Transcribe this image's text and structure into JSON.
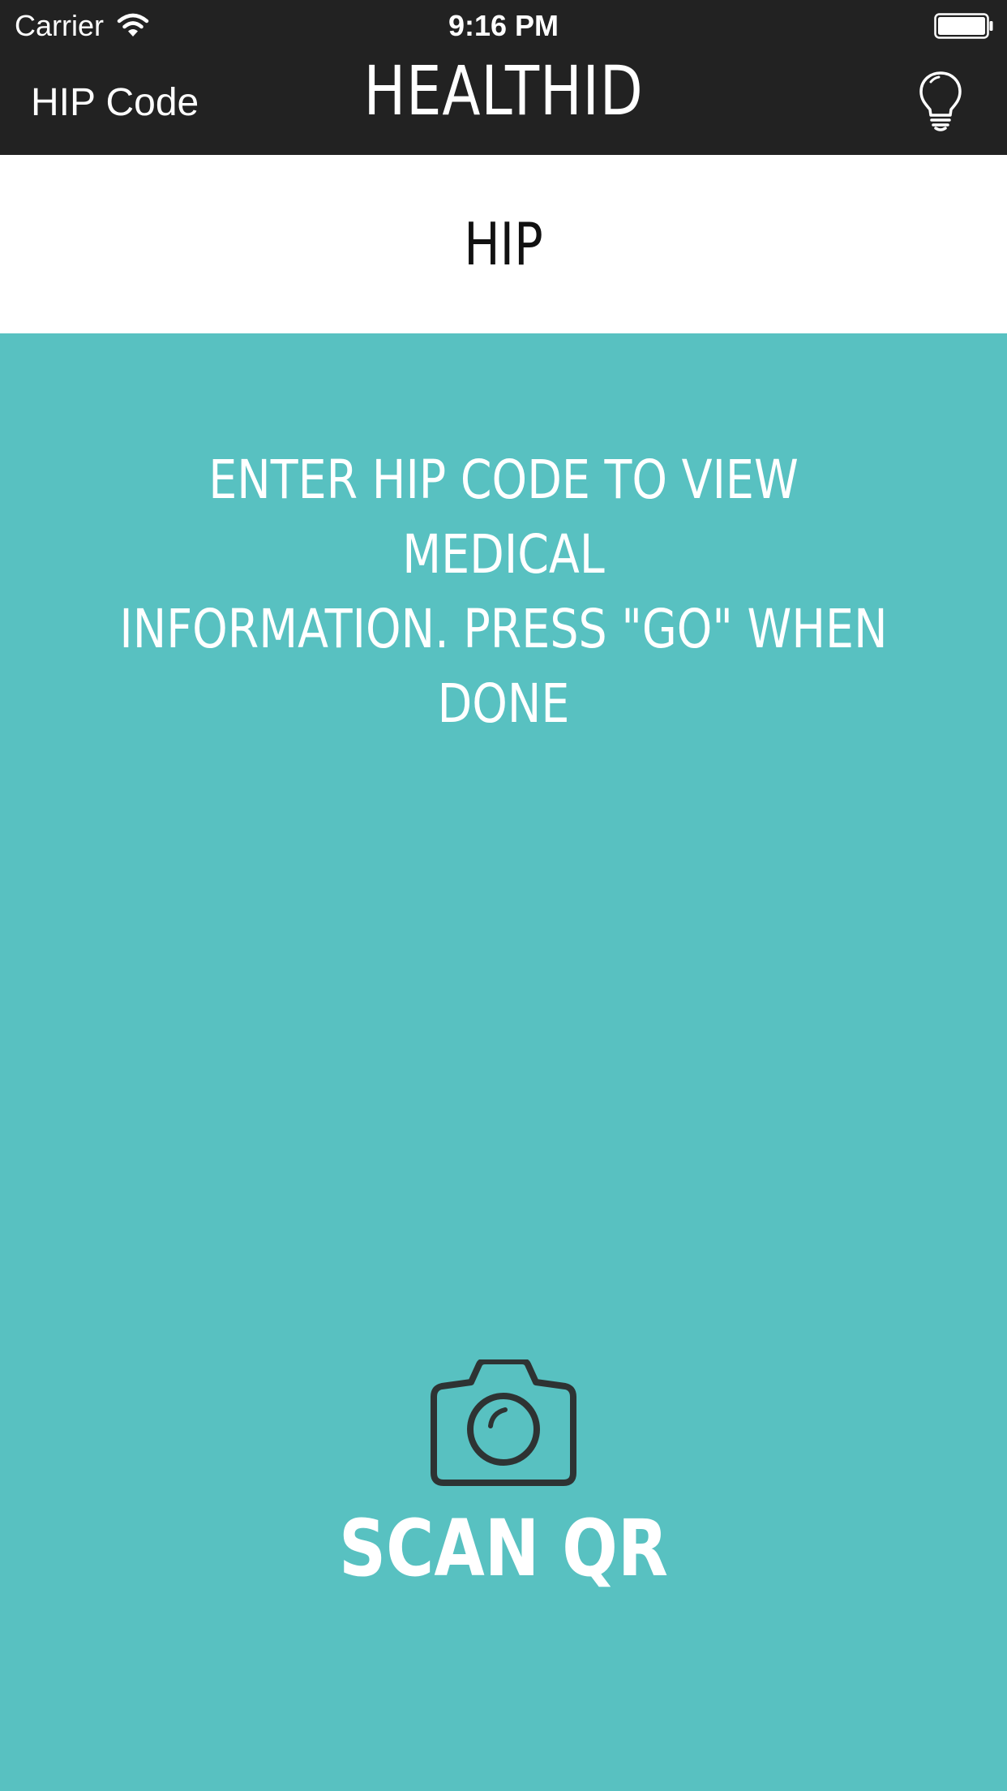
{
  "status_bar": {
    "carrier": "Carrier",
    "time": "9:16 PM",
    "wifi_icon": "wifi-icon",
    "battery_icon": "battery-icon"
  },
  "nav_bar": {
    "back_label": "HIP Code",
    "title": "HEALTHID",
    "right_icon": "lightbulb-icon"
  },
  "header": {
    "label": "HIP"
  },
  "main": {
    "instruction_line1": "ENTER HIP CODE TO VIEW MEDICAL",
    "instruction_line2": "INFORMATION. PRESS \"GO\" WHEN DONE",
    "scan_icon": "camera-icon",
    "scan_label": "SCAN QR"
  },
  "colors": {
    "bar_background": "#222222",
    "header_background": "#ffffff",
    "body_background": "#58c1c1",
    "icon_dark": "#2e3333",
    "text_light": "#ffffff"
  }
}
